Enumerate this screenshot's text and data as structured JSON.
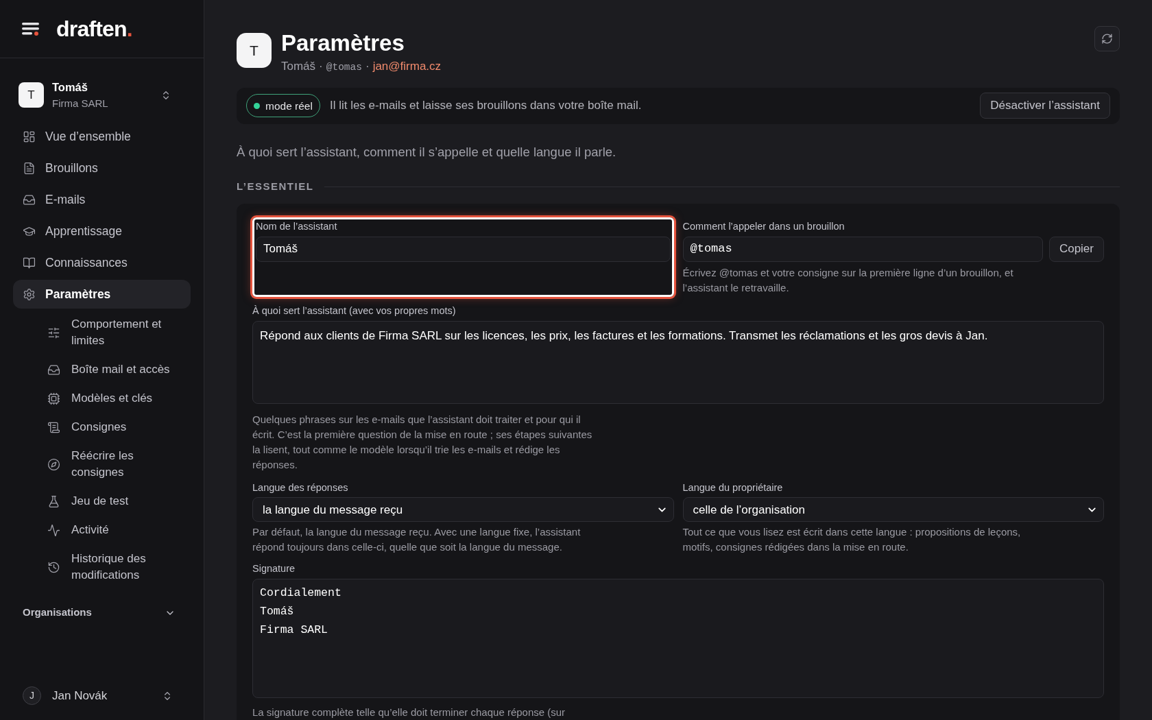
{
  "brand": {
    "text": "draften",
    "mark": "."
  },
  "workspace": {
    "initial": "T",
    "name": "Tomáš",
    "org": "Firma SARL"
  },
  "nav": [
    {
      "label": "Vue d’ensemble",
      "selected": false
    },
    {
      "label": "Brouillons",
      "selected": false
    },
    {
      "label": "E-mails",
      "selected": false
    },
    {
      "label": "Apprentissage",
      "selected": false
    },
    {
      "label": "Connaissances",
      "selected": false
    },
    {
      "label": "Paramètres",
      "selected": true,
      "children": [
        {
          "label": "Comportement et limites",
          "selected": false
        },
        {
          "label": "Boîte mail et accès",
          "selected": false
        },
        {
          "label": "Modèles et clés",
          "selected": false
        },
        {
          "label": "Consignes",
          "selected": false
        },
        {
          "label": "Réécrire les consignes",
          "selected": false
        },
        {
          "label": "Jeu de test",
          "selected": false
        },
        {
          "label": "Activité",
          "selected": false
        },
        {
          "label": "Historique des modifications",
          "selected": false
        }
      ]
    }
  ],
  "organisations": {
    "label": "Organisations",
    "expanded": false
  },
  "user": {
    "initial": "J",
    "name": "Jan Novák"
  },
  "header": {
    "initial": "T",
    "title": "Paramètres",
    "name": "Tomáš",
    "separator": "·",
    "handle": "@tomas",
    "email": "jan@firma.cz"
  },
  "banner": {
    "badge": {
      "label": "mode réel",
      "color": "#34d399"
    },
    "text": "Il lit les e-mails et laisse ses brouillons dans votre boîte mail.",
    "button": "Désactiver l’assistant"
  },
  "intro": "À quoi sert l’assistant, comment il s’appelle et quelle langue il parle.",
  "section": "L’ESSENTIEL",
  "name_field": {
    "label": "Nom de l’assistant",
    "value": "Tomáš",
    "focused": true
  },
  "mention_field": {
    "label": "Comment l’appeler dans un brouillon",
    "value": "@tomas",
    "button": "Copier",
    "hint": "Écrivez @tomas et votre consigne sur la première ligne d’un brouillon, et l’assistant le retravaille."
  },
  "purpose_field": {
    "label": "À quoi sert l’assistant (avec vos propres mots)",
    "value": "Répond aux clients de Firma SARL sur les licences, les prix, les factures et les formations. Transmet les réclamations et les gros devis à Jan.",
    "hint": "Quelques phrases sur les e-mails que l’assistant doit traiter et pour qui il écrit. C’est la première question de la mise en route ; ses étapes suivantes la lisent, tout comme le modèle lorsqu’il trie les e-mails et rédige les réponses."
  },
  "language_fields": [
    {
      "label": "Langue des réponses",
      "value": "la langue du message reçu",
      "hint": "Par défaut, la langue du message reçu. Avec une langue fixe, l’assistant répond toujours dans celle-ci, quelle que soit la langue du message."
    },
    {
      "label": "Langue du propriétaire",
      "value": "celle de l’organisation",
      "hint": "Tout ce que vous lisez est écrit dans cette langue : propositions de leçons, motifs, consignes rédigées dans la mise en route."
    }
  ],
  "signature_field": {
    "label": "Signature",
    "lines": [
      "Cordialement",
      "Tomáš",
      "Firma SARL"
    ],
    "hint": "La signature complète telle qu’elle doit terminer chaque réponse (sur"
  }
}
